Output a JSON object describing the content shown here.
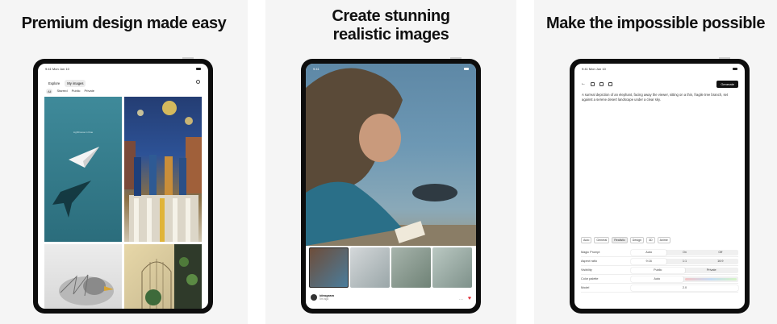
{
  "panels": [
    {
      "headline": "Premium design made easy"
    },
    {
      "headline_line1": "Create stunning",
      "headline_line2": "realistic images"
    },
    {
      "headline": "Make the impossible possible"
    }
  ],
  "screen1": {
    "status_time": "9:41  Mon Jun 10",
    "tabs": [
      "Explore",
      "My images"
    ],
    "active_tab": "My images",
    "filters": [
      "All",
      "Starred",
      "Public",
      "Private"
    ],
    "tile1_caption": "Lighthouse in blue"
  },
  "screen2": {
    "status_time": "9:41",
    "author_name": "ideogram",
    "author_meta": "5m ago"
  },
  "screen3": {
    "status_time": "9:41  Mon Jun 10",
    "generate_label": "Generate",
    "prompt": "A surreal depiction of an elephant, facing away the viewer, sitting on a thin, fragile tree branch, set against a serene desert landscape under a clear sky.",
    "chips": [
      "Auto",
      "General",
      "Realistic",
      "Design",
      "3D",
      "Anime"
    ],
    "settings": [
      {
        "label": "Magic Prompt",
        "options": [
          "Auto",
          "On",
          "Off"
        ],
        "active": "Auto"
      },
      {
        "label": "Aspect ratio",
        "options": [
          "9:16",
          "1:1",
          "16:9"
        ],
        "active": "9:16"
      },
      {
        "label": "Visibility",
        "options": [
          "Public",
          "Private"
        ],
        "active": "Public"
      },
      {
        "label": "Color palette",
        "options": [
          "Auto",
          ""
        ],
        "active": "Auto"
      },
      {
        "label": "Model",
        "options": [
          "2.0"
        ],
        "active": "2.0"
      }
    ]
  },
  "colors": {
    "bezel": "#0d0d0d",
    "panel_bg": "#f5f5f5",
    "accent_red": "#e0303a"
  }
}
